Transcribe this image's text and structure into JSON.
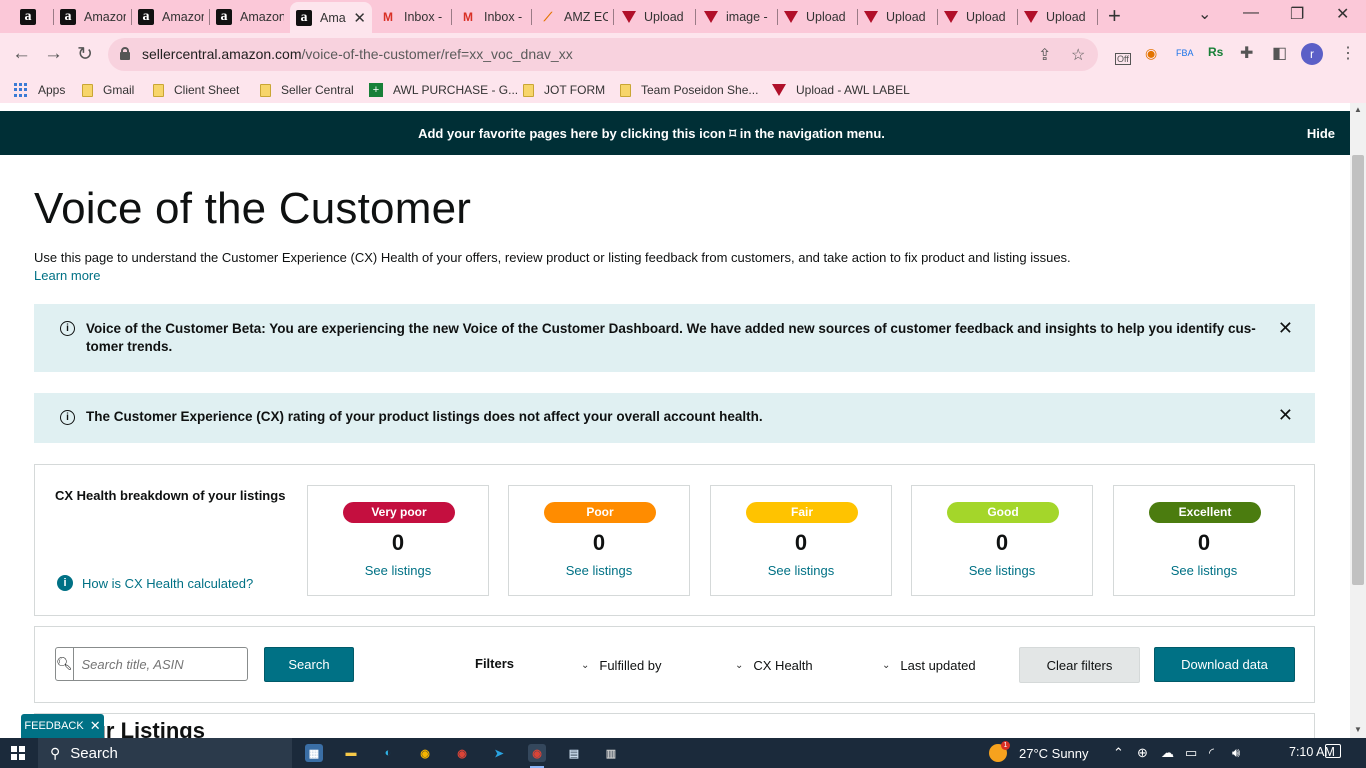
{
  "browser": {
    "tabs": [
      {
        "title": "",
        "favicon": "amazon-a-icon",
        "left": 0
      },
      {
        "title": "Amazon",
        "favicon": "amazon-a-icon"
      },
      {
        "title": "Amazon",
        "favicon": "amazon-a-icon"
      },
      {
        "title": "Amazon",
        "favicon": "amazon-a-icon"
      },
      {
        "title": "Ama",
        "favicon": "amazon-a-icon",
        "active": true
      },
      {
        "title": "Inbox -",
        "favicon": "gmail-icon"
      },
      {
        "title": "Inbox -",
        "favicon": "gmail-icon"
      },
      {
        "title": "AMZ EC",
        "favicon": "amz-ec-icon"
      },
      {
        "title": "Upload",
        "favicon": "upload-triangle-icon"
      },
      {
        "title": "image -",
        "favicon": "upload-triangle-icon"
      },
      {
        "title": "Upload",
        "favicon": "upload-triangle-icon"
      },
      {
        "title": "Upload",
        "favicon": "upload-triangle-icon"
      },
      {
        "title": "Upload",
        "favicon": "upload-triangle-icon"
      },
      {
        "title": "Upload",
        "favicon": "upload-triangle-icon"
      }
    ],
    "url_host": "sellercentral.amazon.com",
    "url_path": "/voice-of-the-customer/ref=xx_voc_dnav_xx",
    "extension_badge": "Off",
    "profile_initial": "r",
    "bookmarks": {
      "apps": "Apps",
      "gmail": "Gmail",
      "client_sheet": "Client Sheet",
      "seller_central": "Seller Central",
      "awl_purchase": "AWL PURCHASE - G...",
      "jot_form": "JOT FORM",
      "team_poseidon": "Team Poseidon She...",
      "upload_awl_label": "Upload - AWL LABEL"
    }
  },
  "page": {
    "favorites_banner": "Add your favorite pages here by clicking this icon ⌑ in the navigation menu.",
    "hide_label": "Hide",
    "title": "Voice of the Customer",
    "description": "Use this page to understand the Customer Experience (CX) Health of your offers, review product or listing feedback from customers, and take action to fix product and listing issues.",
    "learn_more": "Learn more",
    "alert_beta_line1": "Voice of the Customer Beta: You are experiencing the new Voice of the Customer Dashboard. We have added new sources of customer feedback and insights to help you identify cus-",
    "alert_beta_line2": "tomer trends.",
    "alert_cx": "The Customer Experience (CX) rating of your product listings does not affect your overall account health.",
    "cx_heading": "CX Health breakdown of your listings",
    "cx_help": "How is CX Health calculated?",
    "cx_cards": [
      {
        "label": "Very poor",
        "count": "0",
        "link": "See listings",
        "color": "#c40f3f"
      },
      {
        "label": "Poor",
        "count": "0",
        "link": "See listings",
        "color": "#ff8c00"
      },
      {
        "label": "Fair",
        "count": "0",
        "link": "See listings",
        "color": "#ffc300"
      },
      {
        "label": "Good",
        "count": "0",
        "link": "See listings",
        "color": "#a4d62a"
      },
      {
        "label": "Excellent",
        "count": "0",
        "link": "See listings",
        "color": "#4b7c0f"
      }
    ],
    "search_placeholder": "Search title, ASIN",
    "search_button": "Search",
    "filters_label": "Filters",
    "filter_fulfilled": "Fulfilled by",
    "filter_cx_health": "CX Health",
    "filter_last_updated": "Last updated",
    "clear_filters": "Clear filters",
    "download_data": "Download data",
    "listings_title": "Your Listings",
    "feedback_label": "FEEDBACK"
  },
  "taskbar": {
    "search": "Search",
    "weather": "27°C  Sunny",
    "weather_badge": "1",
    "time": "7:10 AM"
  },
  "colors": {
    "teal_button": "#007185",
    "banner_bg": "#002f36",
    "alert_bg": "#e0f0f2",
    "chrome_pink": "#fbc8d8"
  }
}
